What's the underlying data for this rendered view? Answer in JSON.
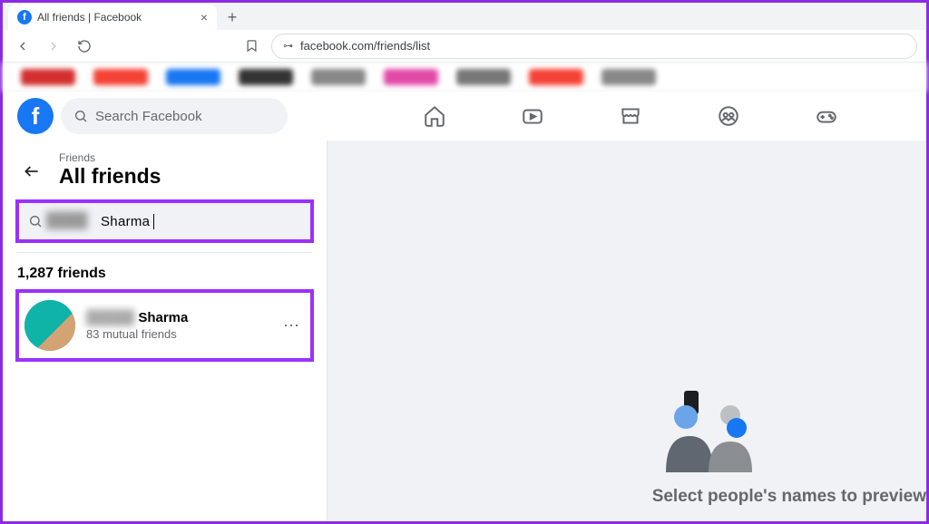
{
  "browser": {
    "tab_title": "All friends | Facebook",
    "url": "facebook.com/friends/list"
  },
  "header": {
    "search_placeholder": "Search Facebook"
  },
  "sidebar": {
    "breadcrumb": "Friends",
    "title": "All friends",
    "search_value_visible": "Sharma",
    "friends_count": "1,287 friends",
    "friend": {
      "name_visible": "Sharma",
      "subtitle": "83 mutual friends"
    }
  },
  "content": {
    "empty_message": "Select people's names to preview"
  }
}
